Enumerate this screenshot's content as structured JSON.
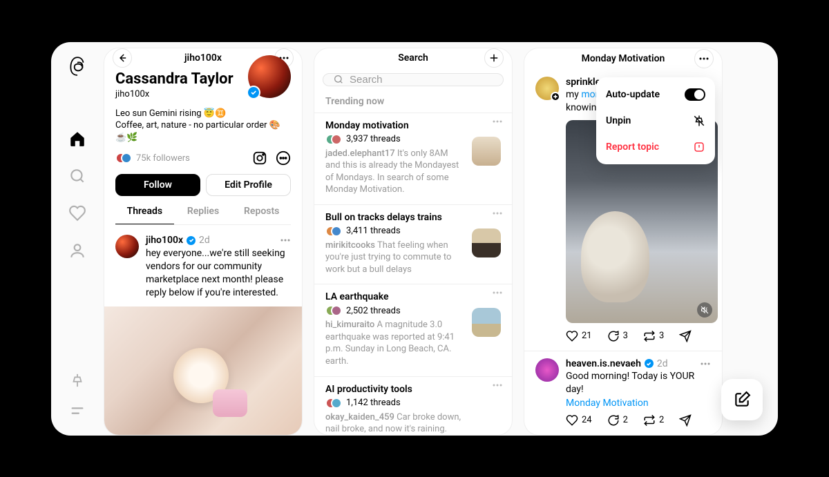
{
  "rail": {
    "items": [
      "home",
      "search",
      "activity",
      "profile"
    ],
    "bottom": [
      "pin",
      "menu"
    ]
  },
  "profile": {
    "header_title": "jiho100x",
    "display_name": "Cassandra Taylor",
    "handle": "jiho100x",
    "bio_line1": "Leo sun Gemini rising 😇♊",
    "bio_line2": "Coffee, art, nature - no particular order 🎨☕🌿",
    "followers": "75k followers",
    "follow_label": "Follow",
    "edit_label": "Edit Profile",
    "tabs": [
      "Threads",
      "Replies",
      "Reposts"
    ],
    "post": {
      "user": "jiho100x",
      "time": "2d",
      "text": "hey everyone...we're still seeking vendors for our community marketplace next month! please reply below if you're interested."
    }
  },
  "search": {
    "header_title": "Search",
    "placeholder": "Search",
    "section_label": "Trending now",
    "trends": [
      {
        "title": "Monday motivation",
        "count": "3,937 threads",
        "sample_author": "jaded.elephant17",
        "sample_text": "It's only 8AM and this is already the Mondayest of Mondays. In search of some Monday Motivation.",
        "thumb": "coffee"
      },
      {
        "title": "Bull on tracks delays trains",
        "count": "3,411 threads",
        "sample_author": "mirikitcooks",
        "sample_text": "That feeling when you're just trying to commute to work but a bull delays",
        "thumb": "silhouette"
      },
      {
        "title": "LA earthquake",
        "count": "2,502 threads",
        "sample_author": "hi_kimuraito",
        "sample_text": "A magnitude 3.0 earthquake was reported at 9:41 p.m. Sunday in Long Beach, CA. earth.",
        "thumb": "beach"
      },
      {
        "title": "AI productivity tools",
        "count": "1,142 threads",
        "sample_author": "okay_kaiden_459",
        "sample_text": "Car broke down, nail broke, and now it's raining. This could only mean one thing... Mercury is in retrograde.",
        "thumb": ""
      }
    ]
  },
  "topic": {
    "header_title": "Monday Motivation",
    "popover": {
      "auto_update": "Auto-update",
      "unpin": "Unpin",
      "report": "Report topic"
    },
    "post1": {
      "user": "sprinkles_b",
      "text_prefix": "my ",
      "link": "monday",
      "text_suffix": " knowing th",
      "likes": "21",
      "replies": "3",
      "reposts": "3"
    },
    "post2": {
      "user": "heaven.is.nevaeh",
      "time": "2d",
      "text": "Good morning! Today is YOUR day!",
      "tag": "Monday Motivation",
      "likes": "24",
      "replies": "2",
      "reposts": "2"
    }
  }
}
